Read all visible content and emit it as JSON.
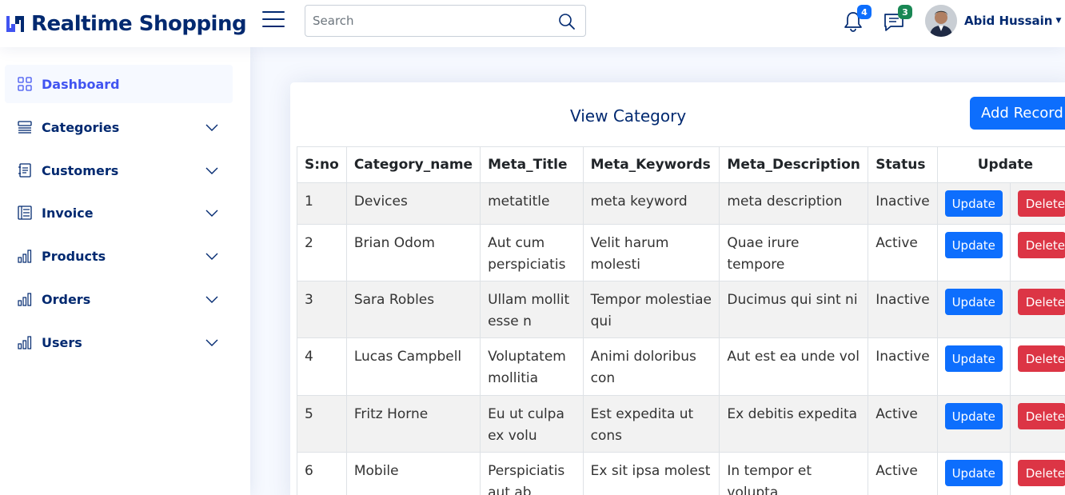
{
  "header": {
    "logo_text": "Realtime Shopping",
    "search_placeholder": "Search",
    "notifications_count": "4",
    "messages_count": "3",
    "user_name": "Abid Hussain"
  },
  "sidebar": {
    "items": [
      {
        "label": "Dashboard",
        "icon": "grid-icon"
      },
      {
        "label": "Categories",
        "icon": "menu-button-icon"
      },
      {
        "label": "Customers",
        "icon": "journal-text-icon"
      },
      {
        "label": "Invoice",
        "icon": "layout-text-icon"
      },
      {
        "label": "Products",
        "icon": "bar-chart-icon"
      },
      {
        "label": "Orders",
        "icon": "bar-chart-icon"
      },
      {
        "label": "Users",
        "icon": "bar-chart-icon"
      }
    ]
  },
  "main": {
    "title": "View Category",
    "add_button": "Add Record",
    "table": {
      "headers": [
        "S:no",
        "Category_name",
        "Meta_Title",
        "Meta_Keywords",
        "Meta_Description",
        "Status",
        "Update"
      ],
      "rows": [
        [
          "1",
          "Devices",
          "metatitle",
          "meta keyword",
          "meta description",
          "Inactive"
        ],
        [
          "2",
          "Brian Odom",
          "Aut cum perspiciatis",
          "Velit harum molesti",
          "Quae irure tempore",
          "Active"
        ],
        [
          "3",
          "Sara Robles",
          "Ullam mollit esse n",
          "Tempor molestiae qui",
          "Ducimus qui sint ni",
          "Inactive"
        ],
        [
          "4",
          "Lucas Campbell",
          "Voluptatem mollitia",
          "Animi doloribus con",
          "Aut est ea unde vol",
          "Inactive"
        ],
        [
          "5",
          "Fritz Horne",
          "Eu ut culpa ex volu",
          "Est expedita ut cons",
          "Ex debitis expedita",
          "Active"
        ],
        [
          "6",
          "Mobile",
          "Perspiciatis aut ab",
          "Ex sit ipsa molest",
          "In tempor et volupta",
          "Active"
        ]
      ],
      "update_label": "Update",
      "delete_label": "Delete"
    }
  },
  "colors": {
    "brand": "#012970",
    "active_nav": "#4154f1",
    "primary": "#0d6efd",
    "danger": "#dc3545",
    "success": "#198754"
  }
}
